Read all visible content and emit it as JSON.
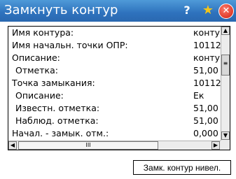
{
  "window": {
    "title": "Замкнуть контур",
    "help_icon": "?",
    "favorite_icon": "★",
    "close_icon": "✕"
  },
  "details": {
    "rows": [
      {
        "label": "Имя контура:",
        "value": "конту",
        "indent": false
      },
      {
        "label": "Имя начальн. точки ОПР:",
        "value": "10112",
        "indent": false
      },
      {
        "label": "Описание:",
        "value": "конту",
        "indent": false
      },
      {
        "label": "Отметка:",
        "value": "51,00",
        "indent": true
      },
      {
        "label": "Точка замыкания:",
        "value": "10112",
        "indent": false
      },
      {
        "label": "Описание:",
        "value": "Ек",
        "indent": true
      },
      {
        "label": "Известн. отметка:",
        "value": "51,00",
        "indent": true
      },
      {
        "label": "Наблюд. отметка:",
        "value": "51,00",
        "indent": true
      },
      {
        "label": "Начал. - замык. отм.:",
        "value": "0,000",
        "indent": false
      },
      {
        "label": "Н      б              ОТ",
        "value": "",
        "indent": false
      }
    ]
  },
  "scrollbar": {
    "up_arrow": "▲",
    "down_arrow": "▼",
    "left_arrow": "◀",
    "right_arrow": "▶",
    "v_grip": "≡",
    "h_grip": "III"
  },
  "footer": {
    "close_loop_button": "Замк. контур нивел."
  }
}
